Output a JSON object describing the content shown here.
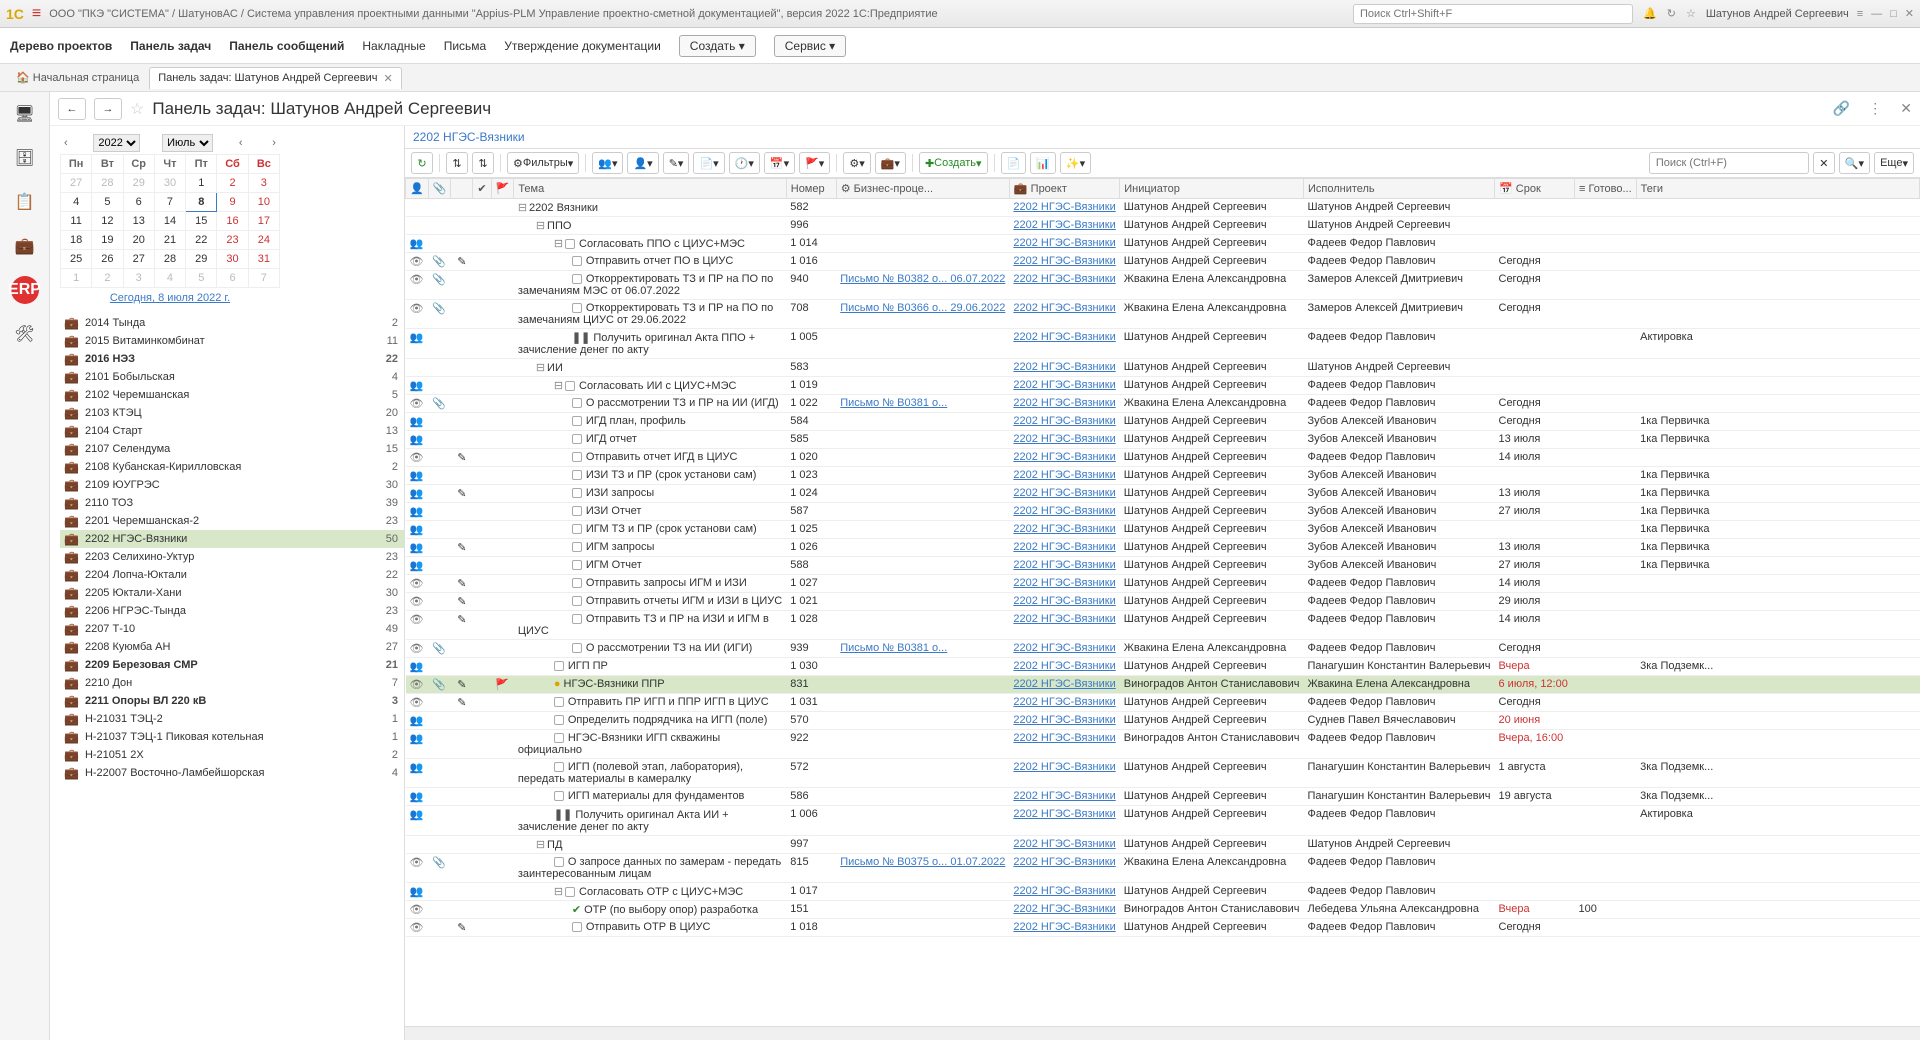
{
  "titlebar": {
    "path": "ООО \"ПКЭ \"СИСТЕМА\" / ШатуновАС / Система управления проектными данными \"Appius-PLM Управление проектно-сметной документацией\", версия 2022 1С:Предприятие",
    "search_placeholder": "Поиск Ctrl+Shift+F",
    "user": "Шатунов Андрей Сергеевич"
  },
  "menubar": {
    "items": [
      "Дерево проектов",
      "Панель задач",
      "Панель сообщений",
      "Накладные",
      "Письма",
      "Утверждение документации"
    ],
    "create": "Создать",
    "service": "Сервис"
  },
  "tabs": {
    "home": "Начальная страница",
    "active": "Панель задач: Шатунов Андрей Сергеевич"
  },
  "page": {
    "title": "Панель задач: Шатунов Андрей Сергеевич",
    "breadcrumb": "2202 НГЭС-Вязники"
  },
  "calendar": {
    "year": "2022",
    "month": "Июль",
    "today_link": "Сегодня, 8 июля 2022 г.",
    "days": [
      "Пн",
      "Вт",
      "Ср",
      "Чт",
      "Пт",
      "Сб",
      "Вс"
    ],
    "weeks": [
      [
        {
          "d": "27",
          "o": true
        },
        {
          "d": "28",
          "o": true
        },
        {
          "d": "29",
          "o": true
        },
        {
          "d": "30",
          "o": true
        },
        {
          "d": "1"
        },
        {
          "d": "2",
          "w": true
        },
        {
          "d": "3",
          "w": true
        }
      ],
      [
        {
          "d": "4"
        },
        {
          "d": "5"
        },
        {
          "d": "6"
        },
        {
          "d": "7"
        },
        {
          "d": "8",
          "t": true
        },
        {
          "d": "9",
          "w": true
        },
        {
          "d": "10",
          "w": true
        }
      ],
      [
        {
          "d": "11"
        },
        {
          "d": "12"
        },
        {
          "d": "13"
        },
        {
          "d": "14"
        },
        {
          "d": "15"
        },
        {
          "d": "16",
          "w": true
        },
        {
          "d": "17",
          "w": true
        }
      ],
      [
        {
          "d": "18"
        },
        {
          "d": "19"
        },
        {
          "d": "20"
        },
        {
          "d": "21"
        },
        {
          "d": "22"
        },
        {
          "d": "23",
          "w": true
        },
        {
          "d": "24",
          "w": true
        }
      ],
      [
        {
          "d": "25"
        },
        {
          "d": "26"
        },
        {
          "d": "27"
        },
        {
          "d": "28"
        },
        {
          "d": "29"
        },
        {
          "d": "30",
          "w": true
        },
        {
          "d": "31",
          "w": true
        }
      ],
      [
        {
          "d": "1",
          "o": true
        },
        {
          "d": "2",
          "o": true
        },
        {
          "d": "3",
          "o": true
        },
        {
          "d": "4",
          "o": true
        },
        {
          "d": "5",
          "o": true
        },
        {
          "d": "6",
          "o": true,
          "w": true
        },
        {
          "d": "7",
          "o": true,
          "w": true
        }
      ]
    ]
  },
  "projects": [
    {
      "name": "2014 Тында",
      "count": "2"
    },
    {
      "name": "2015 Витаминкомбинат",
      "count": "11"
    },
    {
      "name": "2016 НЭЗ",
      "count": "22",
      "bold": true
    },
    {
      "name": "2101 Бобыльская",
      "count": "4"
    },
    {
      "name": "2102 Черемшанская",
      "count": "5"
    },
    {
      "name": "2103 КТЭЦ",
      "count": "20"
    },
    {
      "name": "2104 Старт",
      "count": "13"
    },
    {
      "name": "2107 Селендума",
      "count": "15"
    },
    {
      "name": "2108 Кубанская-Кирилловская",
      "count": "2"
    },
    {
      "name": "2109 ЮУГРЭС",
      "count": "30"
    },
    {
      "name": "2110 ТОЗ",
      "count": "39"
    },
    {
      "name": "2201 Черемшанская-2",
      "count": "23"
    },
    {
      "name": "2202 НГЭС-Вязники",
      "count": "50",
      "selected": true
    },
    {
      "name": "2203 Селихино-Уктур",
      "count": "23"
    },
    {
      "name": "2204 Лопча-Юктали",
      "count": "22"
    },
    {
      "name": "2205 Юктали-Хани",
      "count": "30"
    },
    {
      "name": "2206 НГРЭС-Тында",
      "count": "23"
    },
    {
      "name": "2207 Т-10",
      "count": "49"
    },
    {
      "name": "2208 Куюмба АН",
      "count": "27"
    },
    {
      "name": "2209 Березовая СМР",
      "count": "21",
      "bold": true
    },
    {
      "name": "2210 Дон",
      "count": "7"
    },
    {
      "name": "2211 Опоры ВЛ 220 кВ",
      "count": "3",
      "bold": true
    },
    {
      "name": "Н-21031 ТЭЦ-2",
      "count": "1",
      "alt": true
    },
    {
      "name": "Н-21037 ТЭЦ-1 Пиковая котельная",
      "count": "1",
      "alt": true
    },
    {
      "name": "Н-21051 2Х",
      "count": "2",
      "alt": true
    },
    {
      "name": "Н-22007 Восточно-Ламбейшорская",
      "count": "4",
      "alt": true
    }
  ],
  "toolbar": {
    "filters": "Фильтры",
    "create": "Создать",
    "more": "Еще",
    "search_placeholder": "Поиск (Ctrl+F)"
  },
  "grid": {
    "headers": {
      "tema": "Тема",
      "nomer": "Номер",
      "bp": "Бизнес-проце...",
      "proekt": "Проект",
      "init": "Инициатор",
      "isp": "Исполнитель",
      "srok": "Срок",
      "gotov": "Готово...",
      "tegi": "Теги"
    },
    "rows": [
      {
        "indent": 0,
        "exp": "⊟",
        "tema": "2202 Вязники",
        "nomer": "582",
        "proekt": "2202 НГЭС-Вязники",
        "init": "Шатунов Андрей Сергеевич",
        "isp": "Шатунов Андрей Сергеевич"
      },
      {
        "indent": 1,
        "exp": "⊟",
        "tema": "ППО",
        "nomer": "996",
        "proekt": "2202 НГЭС-Вязники",
        "init": "Шатунов Андрей Сергеевич",
        "isp": "Шатунов Андрей Сергеевич"
      },
      {
        "i1": "👥",
        "indent": 2,
        "exp": "⊟",
        "chk": true,
        "tema": "Согласовать ППО с ЦИУС+МЭС",
        "nomer": "1 014",
        "proekt": "2202 НГЭС-Вязники",
        "init": "Шатунов Андрей Сергеевич",
        "isp": "Фадеев Федор Павлович"
      },
      {
        "i1": "👁",
        "i2": "📎",
        "i3": "✎",
        "indent": 3,
        "chk": true,
        "tema": "Отправить отчет ПО в ЦИУС",
        "nomer": "1 016",
        "proekt": "2202 НГЭС-Вязники",
        "init": "Шатунов Андрей Сергеевич",
        "isp": "Фадеев Федор Павлович",
        "srok": "Сегодня"
      },
      {
        "i1": "👁",
        "i2": "📎",
        "indent": 3,
        "chk": true,
        "tema": "Откорректировать ТЗ и ПР на ПО по замечаниям МЭС от 06.07.2022",
        "nomer": "940",
        "bp": "Письмо № В0382 о... 06.07.2022",
        "proekt": "2202 НГЭС-Вязники",
        "init": "Жвакина Елена Александровна",
        "isp": "Замеров Алексей Дмитриевич",
        "srok": "Сегодня",
        "wrap": true
      },
      {
        "i1": "👁",
        "i2": "📎",
        "indent": 3,
        "chk": true,
        "tema": "Откорректировать ТЗ и ПР на ПО по замечаниям ЦИУС от 29.06.2022",
        "nomer": "708",
        "bp": "Письмо № В0366 о... 29.06.2022",
        "proekt": "2202 НГЭС-Вязники",
        "init": "Жвакина Елена Александровна",
        "isp": "Замеров Алексей Дмитриевич",
        "srok": "Сегодня",
        "wrap": true
      },
      {
        "i1": "👥",
        "indent": 3,
        "pause": true,
        "tema": "Получить оригинал Акта ППО + зачисление денег по акту",
        "nomer": "1 005",
        "proekt": "2202 НГЭС-Вязники",
        "init": "Шатунов Андрей Сергеевич",
        "isp": "Фадеев Федор Павлович",
        "tegi": "Актировка",
        "wrap": true
      },
      {
        "indent": 1,
        "exp": "⊟",
        "tema": "ИИ",
        "nomer": "583",
        "proekt": "2202 НГЭС-Вязники",
        "init": "Шатунов Андрей Сергеевич",
        "isp": "Шатунов Андрей Сергеевич"
      },
      {
        "i1": "👥",
        "indent": 2,
        "exp": "⊟",
        "chk": true,
        "tema": "Согласовать ИИ с ЦИУС+МЭС",
        "nomer": "1 019",
        "proekt": "2202 НГЭС-Вязники",
        "init": "Шатунов Андрей Сергеевич",
        "isp": "Фадеев Федор Павлович"
      },
      {
        "i1": "👁",
        "i2": "📎",
        "indent": 3,
        "chk": true,
        "tema": "О рассмотрении ТЗ и ПР на ИИ (ИГД)",
        "nomer": "1 022",
        "bp": "Письмо № В0381 о...",
        "proekt": "2202 НГЭС-Вязники",
        "init": "Жвакина Елена Александровна",
        "isp": "Фадеев Федор Павлович",
        "srok": "Сегодня"
      },
      {
        "i1": "👥",
        "indent": 3,
        "chk": true,
        "tema": "ИГД план, профиль",
        "nomer": "584",
        "proekt": "2202 НГЭС-Вязники",
        "init": "Шатунов Андрей Сергеевич",
        "isp": "Зубов Алексей Иванович",
        "srok": "Сегодня",
        "tegi": "1ка Первичка"
      },
      {
        "i1": "👥",
        "indent": 3,
        "chk": true,
        "tema": "ИГД отчет",
        "nomer": "585",
        "proekt": "2202 НГЭС-Вязники",
        "init": "Шатунов Андрей Сергеевич",
        "isp": "Зубов Алексей Иванович",
        "srok": "13 июля",
        "tegi": "1ка Первичка"
      },
      {
        "i1": "👁",
        "i3": "✎",
        "indent": 3,
        "chk": true,
        "tema": "Отправить отчет ИГД в ЦИУС",
        "nomer": "1 020",
        "proekt": "2202 НГЭС-Вязники",
        "init": "Шатунов Андрей Сергеевич",
        "isp": "Фадеев Федор Павлович",
        "srok": "14 июля"
      },
      {
        "i1": "👥",
        "indent": 3,
        "chk": true,
        "tema": "ИЗИ ТЗ и ПР (срок установи сам)",
        "nomer": "1 023",
        "proekt": "2202 НГЭС-Вязники",
        "init": "Шатунов Андрей Сергеевич",
        "isp": "Зубов Алексей Иванович",
        "tegi": "1ка Первичка"
      },
      {
        "i1": "👥",
        "i3": "✎",
        "indent": 3,
        "chk": true,
        "tema": "ИЗИ запросы",
        "nomer": "1 024",
        "proekt": "2202 НГЭС-Вязники",
        "init": "Шатунов Андрей Сергеевич",
        "isp": "Зубов Алексей Иванович",
        "srok": "13 июля",
        "tegi": "1ка Первичка"
      },
      {
        "i1": "👥",
        "indent": 3,
        "chk": true,
        "tema": "ИЗИ Отчет",
        "nomer": "587",
        "proekt": "2202 НГЭС-Вязники",
        "init": "Шатунов Андрей Сергеевич",
        "isp": "Зубов Алексей Иванович",
        "srok": "27 июля",
        "tegi": "1ка Первичка"
      },
      {
        "i1": "👥",
        "indent": 3,
        "chk": true,
        "tema": "ИГМ ТЗ и ПР (срок установи сам)",
        "nomer": "1 025",
        "proekt": "2202 НГЭС-Вязники",
        "init": "Шатунов Андрей Сергеевич",
        "isp": "Зубов Алексей Иванович",
        "tegi": "1ка Первичка"
      },
      {
        "i1": "👥",
        "i3": "✎",
        "indent": 3,
        "chk": true,
        "tema": "ИГМ запросы",
        "nomer": "1 026",
        "proekt": "2202 НГЭС-Вязники",
        "init": "Шатунов Андрей Сергеевич",
        "isp": "Зубов Алексей Иванович",
        "srok": "13 июля",
        "tegi": "1ка Первичка"
      },
      {
        "i1": "👥",
        "indent": 3,
        "chk": true,
        "tema": "ИГМ Отчет",
        "nomer": "588",
        "proekt": "2202 НГЭС-Вязники",
        "init": "Шатунов Андрей Сергеевич",
        "isp": "Зубов Алексей Иванович",
        "srok": "27 июля",
        "tegi": "1ка Первичка"
      },
      {
        "i1": "👁",
        "i3": "✎",
        "indent": 3,
        "chk": true,
        "tema": "Отправить запросы ИГМ и ИЗИ",
        "nomer": "1 027",
        "proekt": "2202 НГЭС-Вязники",
        "init": "Шатунов Андрей Сергеевич",
        "isp": "Фадеев Федор Павлович",
        "srok": "14 июля"
      },
      {
        "i1": "👁",
        "i3": "✎",
        "indent": 3,
        "chk": true,
        "tema": "Отправить отчеты ИГМ и ИЗИ в ЦИУС",
        "nomer": "1 021",
        "proekt": "2202 НГЭС-Вязники",
        "init": "Шатунов Андрей Сергеевич",
        "isp": "Фадеев Федор Павлович",
        "srok": "29 июля"
      },
      {
        "i1": "👁",
        "i3": "✎",
        "indent": 3,
        "chk": true,
        "tema": "Отправить ТЗ и ПР на ИЗИ и ИГМ в ЦИУС",
        "nomer": "1 028",
        "proekt": "2202 НГЭС-Вязники",
        "init": "Шатунов Андрей Сергеевич",
        "isp": "Фадеев Федор Павлович",
        "srok": "14 июля",
        "wrap": true
      },
      {
        "i1": "👁",
        "i2": "📎",
        "indent": 3,
        "chk": true,
        "tema": "О рассмотрении ТЗ на ИИ (ИГИ)",
        "nomer": "939",
        "bp": "Письмо № В0381 о...",
        "proekt": "2202 НГЭС-Вязники",
        "init": "Жвакина Елена Александровна",
        "isp": "Фадеев Федор Павлович",
        "srok": "Сегодня"
      },
      {
        "i1": "👥",
        "indent": 2,
        "chk": true,
        "tema": "ИГП ПР",
        "nomer": "1 030",
        "proekt": "2202 НГЭС-Вязники",
        "init": "Шатунов Андрей Сергеевич",
        "isp": "Панагушин Константин Валерьевич",
        "srok": "Вчера",
        "srokred": true,
        "tegi": "3ка Подземк..."
      },
      {
        "sel": true,
        "i1": "👁",
        "i2": "📎",
        "i3": "✎",
        "flag": true,
        "indent": 2,
        "chk": "pending",
        "tema": "НГЭС-Вязники  ППР",
        "nomer": "831",
        "proekt": "2202 НГЭС-Вязники",
        "init": "Виноградов Антон Станиславович",
        "isp": "Жвакина Елена Александровна",
        "srok": "6 июля, 12:00",
        "srokred": true
      },
      {
        "i1": "👁",
        "i3": "✎",
        "indent": 2,
        "chk": true,
        "tema": "Отправить ПР ИГП и ППР ИГП в ЦИУС",
        "nomer": "1 031",
        "proekt": "2202 НГЭС-Вязники",
        "init": "Шатунов Андрей Сергеевич",
        "isp": "Фадеев Федор Павлович",
        "srok": "Сегодня"
      },
      {
        "i1": "👥",
        "indent": 2,
        "chk": true,
        "tema": "Определить подрядчика на ИГП (поле)",
        "nomer": "570",
        "proekt": "2202 НГЭС-Вязники",
        "init": "Шатунов Андрей Сергеевич",
        "isp": "Суднев Павел Вячеславович",
        "srok": "20 июня",
        "srokred": true
      },
      {
        "i1": "👥",
        "indent": 2,
        "chk": true,
        "tema": "НГЭС-Вязники ИГП скважины официально",
        "nomer": "922",
        "proekt": "2202 НГЭС-Вязники",
        "init": "Виноградов Антон Станиславович",
        "isp": "Фадеев Федор Павлович",
        "srok": "Вчера, 16:00",
        "srokred": true,
        "wrap": true
      },
      {
        "i1": "👥",
        "indent": 2,
        "chk": true,
        "tema": "ИГП (полевой этап, лаборатория), передать материалы в камералку",
        "nomer": "572",
        "proekt": "2202 НГЭС-Вязники",
        "init": "Шатунов Андрей Сергеевич",
        "isp": "Панагушин Константин Валерьевич",
        "srok": "1 августа",
        "tegi": "3ка Подземк...",
        "wrap": true
      },
      {
        "i1": "👥",
        "indent": 2,
        "chk": true,
        "tema": "ИГП материалы для фундаментов",
        "nomer": "586",
        "proekt": "2202 НГЭС-Вязники",
        "init": "Шатунов Андрей Сергеевич",
        "isp": "Панагушин Константин Валерьевич",
        "srok": "19 августа",
        "tegi": "3ка Подземк..."
      },
      {
        "i1": "👥",
        "indent": 2,
        "pause": true,
        "tema": "Получить оригинал Акта ИИ + зачисление денег по акту",
        "nomer": "1 006",
        "proekt": "2202 НГЭС-Вязники",
        "init": "Шатунов Андрей Сергеевич",
        "isp": "Фадеев Федор Павлович",
        "tegi": "Актировка",
        "wrap": true
      },
      {
        "indent": 1,
        "exp": "⊟",
        "tema": "ПД",
        "nomer": "997",
        "proekt": "2202 НГЭС-Вязники",
        "init": "Шатунов Андрей Сергеевич",
        "isp": "Шатунов Андрей Сергеевич"
      },
      {
        "i1": "👁",
        "i2": "📎",
        "indent": 2,
        "chk": true,
        "tema": "О запросе данных по замерам - передать заинтересованным лицам",
        "nomer": "815",
        "bp": "Письмо № В0375 о... 01.07.2022",
        "proekt": "2202 НГЭС-Вязники",
        "init": "Жвакина Елена Александровна",
        "isp": "Фадеев Федор Павлович",
        "wrap": true
      },
      {
        "i1": "👥",
        "indent": 2,
        "exp": "⊟",
        "chk": true,
        "tema": "Согласовать ОТР с ЦИУС+МЭС",
        "nomer": "1 017",
        "proekt": "2202 НГЭС-Вязники",
        "init": "Шатунов Андрей Сергеевич",
        "isp": "Фадеев Федор Павлович"
      },
      {
        "i1": "👁",
        "indent": 3,
        "chk": "done",
        "tema": "ОТР (по выбору опор) разработка",
        "nomer": "151",
        "proekt": "2202 НГЭС-Вязники",
        "init": "Виноградов Антон Станиславович",
        "isp": "Лебедева Ульяна Александровна",
        "srok": "Вчера",
        "srokred": true,
        "gotov": "100"
      },
      {
        "i1": "👁",
        "i3": "✎",
        "indent": 3,
        "chk": true,
        "tema": "Отправить ОТР В ЦИУС",
        "nomer": "1 018",
        "proekt": "2202 НГЭС-Вязники",
        "init": "Шатунов Андрей Сергеевич",
        "isp": "Фадеев Федор Павлович",
        "srok": "Сегодня"
      }
    ]
  }
}
